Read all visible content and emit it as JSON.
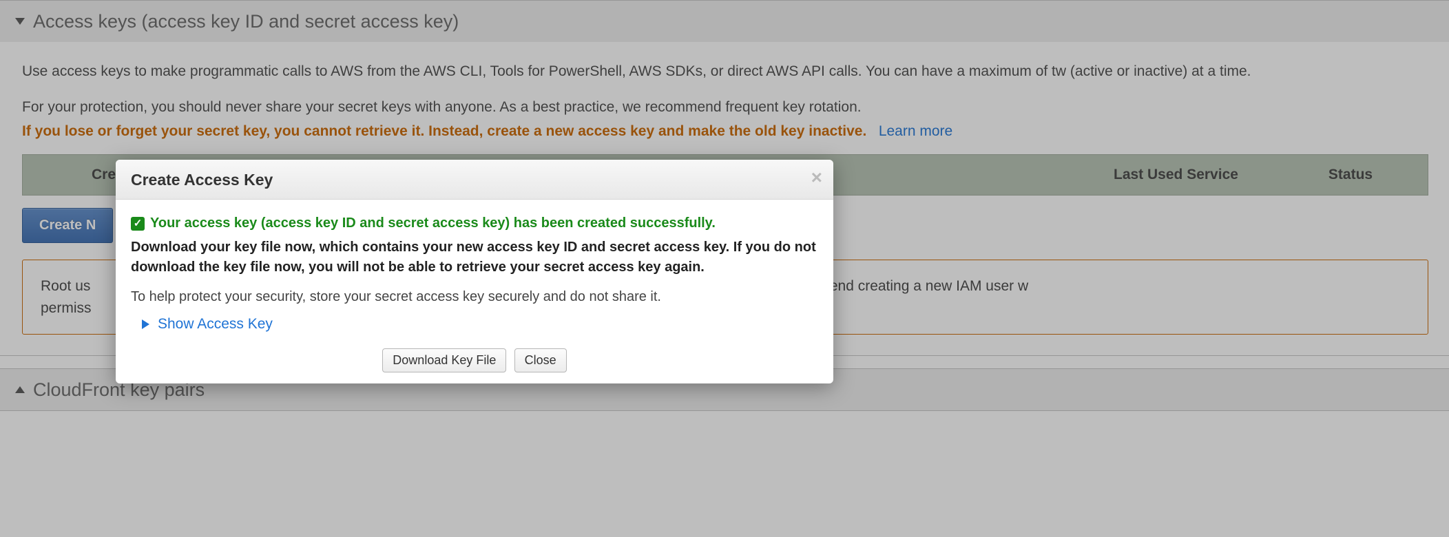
{
  "section": {
    "title": "Access keys (access key ID and secret access key)",
    "intro": "Use access keys to make programmatic calls to AWS from the AWS CLI, Tools for PowerShell, AWS SDKs, or direct AWS API calls. You can have a maximum of tw (active or inactive) at a time.",
    "protect": "For your protection, you should never share your secret keys with anyone. As a best practice, we recommend frequent key rotation.",
    "lose_warning": "If you lose or forget your secret key, you cannot retrieve it. Instead, create a new access key and make the old key inactive.",
    "learn_more": "Learn more",
    "table": {
      "created": "Crea",
      "last_used_service": "Last Used Service",
      "status": "Status"
    },
    "create_btn": "Create N",
    "root_note_a": "Root us",
    "root_note_b": "recommend creating a new IAM user w",
    "root_note_c": "permiss"
  },
  "section2": {
    "title": "CloudFront key pairs"
  },
  "modal": {
    "title": "Create Access Key",
    "success": "Your access key (access key ID and secret access key) has been created successfully.",
    "download_warn": "Download your key file now, which contains your new access key ID and secret access key. If you do not download the key file now, you will not be able to retrieve your secret access key again.",
    "store_note": "To help protect your security, store your secret access key securely and do not share it.",
    "show_label": "Show Access Key",
    "download_btn": "Download Key File",
    "close_btn": "Close"
  }
}
